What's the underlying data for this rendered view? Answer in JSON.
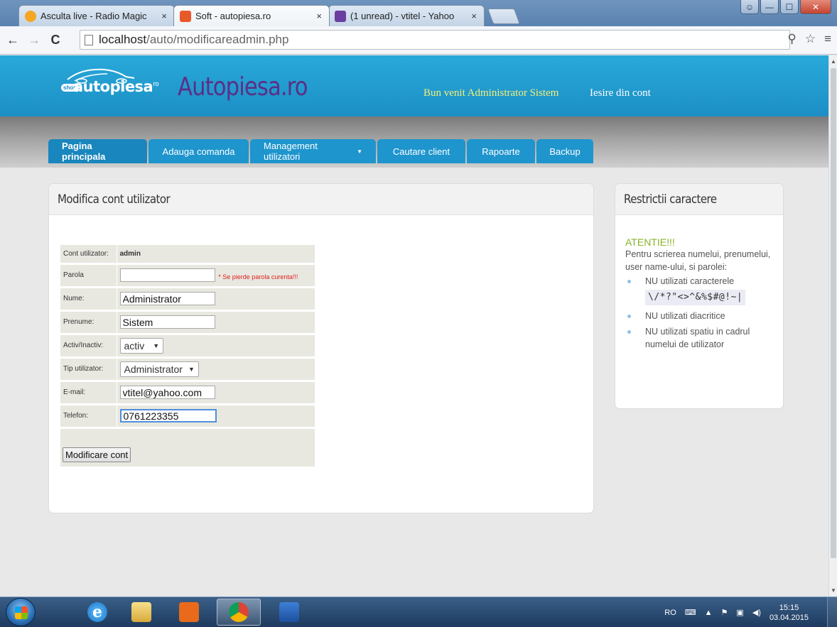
{
  "browser": {
    "tabs": [
      {
        "label": "Asculta live - Radio Magic",
        "icon_color": "#f5a623"
      },
      {
        "label": "Soft - autopiesa.ro",
        "icon_color": "#e8592a"
      },
      {
        "label": "(1 unread) - vtitel - Yahoo",
        "icon_color": "#6b3fa0"
      }
    ],
    "url_host": "localhost",
    "url_path": "/auto/modificareadmin.php",
    "back_icon": "arrow-left-icon",
    "forward_icon": "arrow-right-icon",
    "reload_icon": "reload-icon"
  },
  "header": {
    "logo_shop": "shop",
    "logo_text": "autopiesa",
    "logo_suffix": "ro",
    "title": "Autopiesa.ro",
    "welcome": "Bun venit Administrator Sistem",
    "logout": "Iesire din cont"
  },
  "menu": [
    {
      "label": "Pagina principala",
      "active": true
    },
    {
      "label": "Adauga comanda"
    },
    {
      "label": "Management utilizatori",
      "dropdown": true
    },
    {
      "label": "Cautare client"
    },
    {
      "label": "Rapoarte"
    },
    {
      "label": "Backup"
    }
  ],
  "form": {
    "heading": "Modifica cont utilizator",
    "account_label": "Cont utilizator:",
    "account_value": "admin",
    "password_label": "Parola",
    "password_value": "",
    "password_warning": "* Se pierde parola curenta!!!",
    "name_label": "Nume:",
    "name_value": "Administrator",
    "surname_label": "Prenume:",
    "surname_value": "Sistem",
    "status_label": "Activ/Inactiv:",
    "status_value": "activ",
    "type_label": "Tip utilizator:",
    "type_value": "Administrator",
    "email_label": "E-mail:",
    "email_value": "vtitel@yahoo.com",
    "phone_label": "Telefon:",
    "phone_value": "0761223355",
    "submit_label": "Modificare cont"
  },
  "sidebar": {
    "heading": "Restrictii caractere",
    "warning": "ATENTIE!!!",
    "intro": "Pentru scrierea numelui, prenumelui, user name-ului, si parolei:",
    "rule1": "NU utilizati caracterele",
    "forbidden_chars": "\\/*?\"<>^&%$#@!~|",
    "rule2": "NU utilizati diacritice",
    "rule3": "NU utilizati spatiu in cadrul numelui de utilizator"
  },
  "taskbar": {
    "language": "RO",
    "time": "15:15",
    "date": "03.04.2015"
  },
  "colors": {
    "header_blue": "#1e95cd",
    "title_purple": "#5b2f86",
    "welcome_yellow": "#f2f07a",
    "warning_red": "#e02020",
    "atentie_green": "#8ab228"
  }
}
